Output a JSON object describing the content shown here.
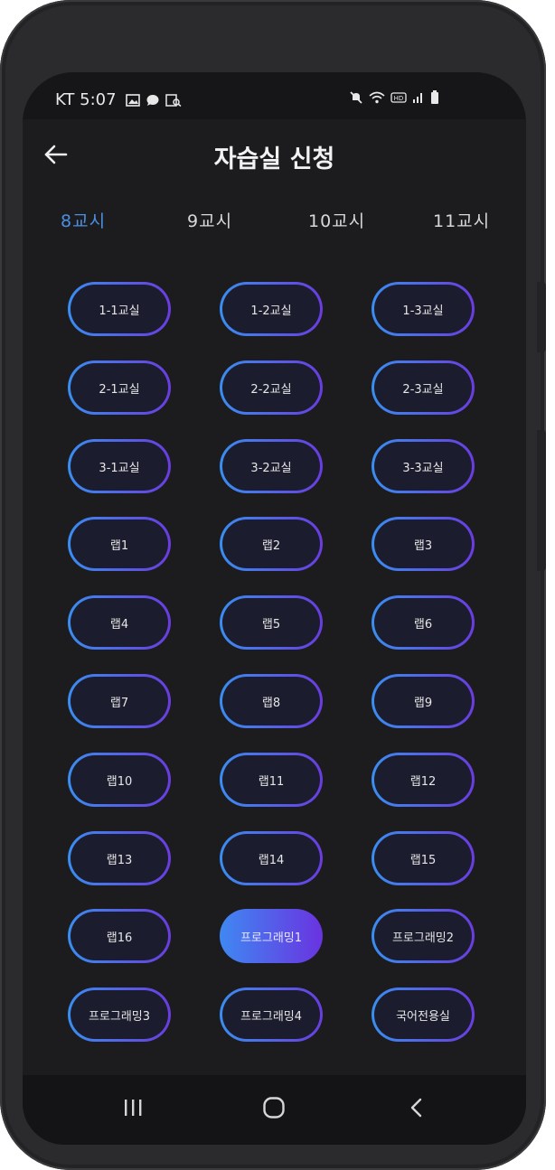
{
  "status_bar": {
    "carrier_time": "KT 5:07",
    "icons_left": [
      "image-icon",
      "chat-bubble-icon",
      "gallery-search-icon"
    ],
    "icons_right": [
      "mute-icon",
      "wifi-icon",
      "hd-icon",
      "signal-icon",
      "battery-icon"
    ]
  },
  "header": {
    "title": "자습실 신청"
  },
  "tabs": [
    {
      "label": "8교시",
      "active": true
    },
    {
      "label": "9교시",
      "active": false
    },
    {
      "label": "10교시",
      "active": false
    },
    {
      "label": "11교시",
      "active": false
    }
  ],
  "rooms": [
    {
      "label": "1-1교실"
    },
    {
      "label": "1-2교실"
    },
    {
      "label": "1-3교실"
    },
    {
      "label": "2-1교실"
    },
    {
      "label": "2-2교실"
    },
    {
      "label": "2-3교실"
    },
    {
      "label": "3-1교실"
    },
    {
      "label": "3-2교실"
    },
    {
      "label": "3-3교실"
    },
    {
      "label": "랩1"
    },
    {
      "label": "랩2"
    },
    {
      "label": "랩3"
    },
    {
      "label": "랩4"
    },
    {
      "label": "랩5"
    },
    {
      "label": "랩6"
    },
    {
      "label": "랩7"
    },
    {
      "label": "랩8"
    },
    {
      "label": "랩9"
    },
    {
      "label": "랩10"
    },
    {
      "label": "랩11"
    },
    {
      "label": "랩12"
    },
    {
      "label": "랩13"
    },
    {
      "label": "랩14"
    },
    {
      "label": "랩15"
    },
    {
      "label": "랩16"
    },
    {
      "label": "프로그래밍1",
      "selected": true
    },
    {
      "label": "프로그래밍2"
    },
    {
      "label": "프로그래밍3"
    },
    {
      "label": "프로그래밍4"
    },
    {
      "label": "국어전용실"
    }
  ],
  "nav": {
    "buttons": [
      "recent-apps-icon",
      "home-icon",
      "back-icon"
    ]
  },
  "colors": {
    "accent_tab": "#4a90e2",
    "button_gradient_start": "#3a8ef0",
    "button_gradient_end": "#6a3ce0"
  }
}
